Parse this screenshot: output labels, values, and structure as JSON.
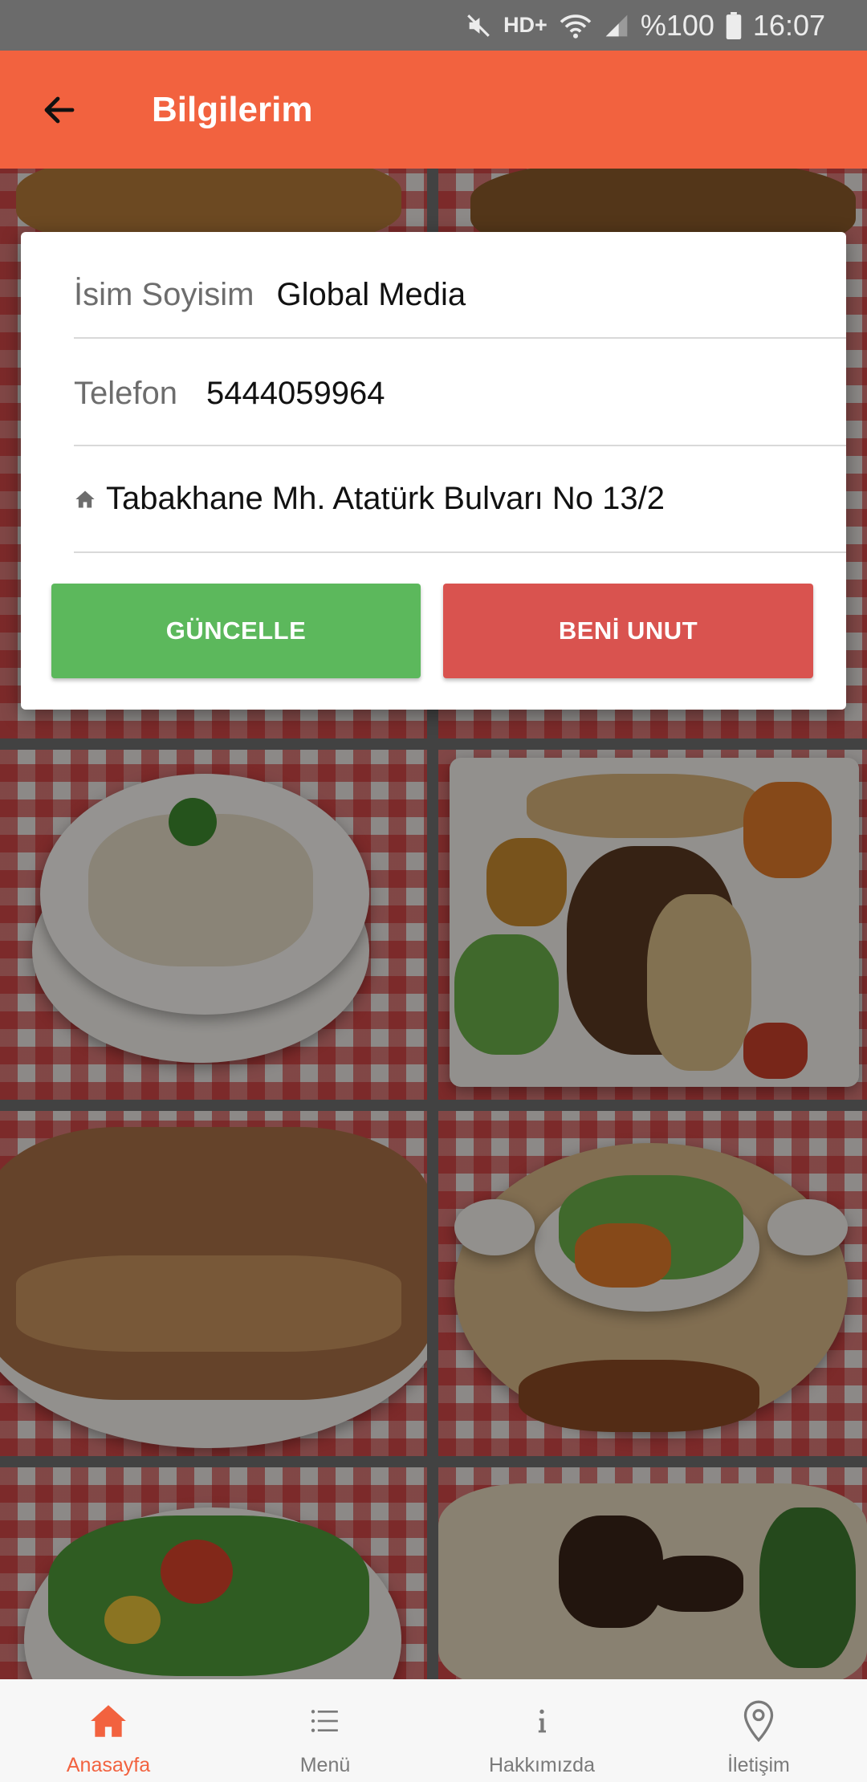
{
  "status_bar": {
    "network": "HD+",
    "battery": "%100",
    "time": "16:07"
  },
  "app_bar": {
    "title": "Bilgilerim"
  },
  "profile": {
    "name_label": "İsim Soyisim",
    "name_value": "Global Media",
    "phone_label": "Telefon",
    "phone_value": "5444059964",
    "address_value": "Tabakhane Mh. Atatürk Bulvarı No 13/2"
  },
  "buttons": {
    "update": "GÜNCELLE",
    "forget": "BENİ UNUT"
  },
  "colors": {
    "primary": "#f2623f",
    "update": "#5cb85c",
    "forget": "#d9534f"
  },
  "bottom_nav": {
    "items": [
      {
        "label": "Anasayfa",
        "icon": "home-icon",
        "active": true
      },
      {
        "label": "Menü",
        "icon": "list-icon",
        "active": false
      },
      {
        "label": "Hakkımızda",
        "icon": "info-icon",
        "active": false
      },
      {
        "label": "İletişim",
        "icon": "location-pin-icon",
        "active": false
      }
    ]
  }
}
